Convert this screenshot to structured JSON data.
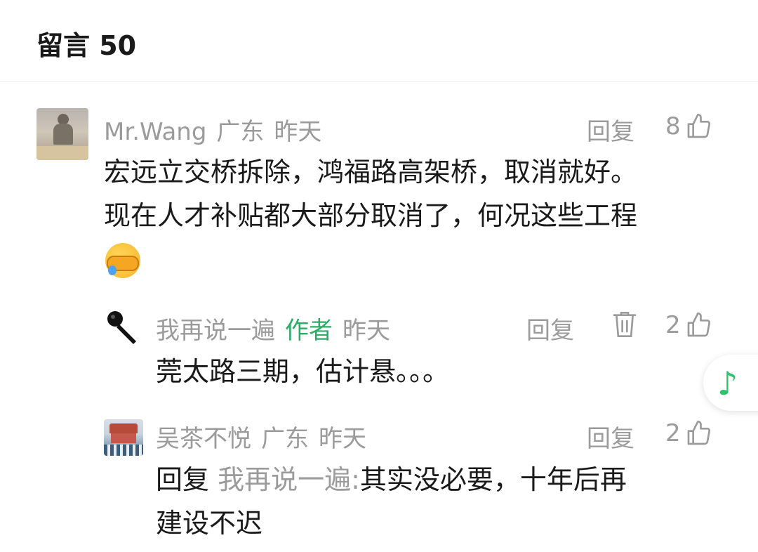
{
  "header": {
    "title": "留言 50"
  },
  "comments": [
    {
      "user": "Mr.Wang",
      "region": "广东",
      "time": "昨天",
      "reply_label": "回复",
      "likes": "8",
      "text_lines": [
        "宏远立交桥拆除，鸿福路高架桥，取消就好。",
        "现在人才补贴都大部分取消了，何况这些工程"
      ],
      "emoji": "facepalm-crying-emoji"
    },
    {
      "user": "我再说一遍",
      "author_tag": "作者",
      "time": "昨天",
      "reply_label": "回复",
      "likes": "2",
      "text_lines": [
        "莞太路三期，估计悬。。。"
      ]
    },
    {
      "user": "吴茶不悦",
      "region": "广东",
      "time": "昨天",
      "reply_label": "回复",
      "likes": "2",
      "reply_prefix": "回复",
      "reply_target": "我再说一遍:",
      "text_lines": [
        "其实没必要，十年后再",
        "建设不迟"
      ]
    }
  ],
  "float_button": {
    "icon": "music-note-icon",
    "color": "#2bc36b"
  },
  "colors": {
    "meta_gray": "#9b9b9b",
    "author_green": "#2aae67",
    "text_dark": "#1a1a1a"
  }
}
